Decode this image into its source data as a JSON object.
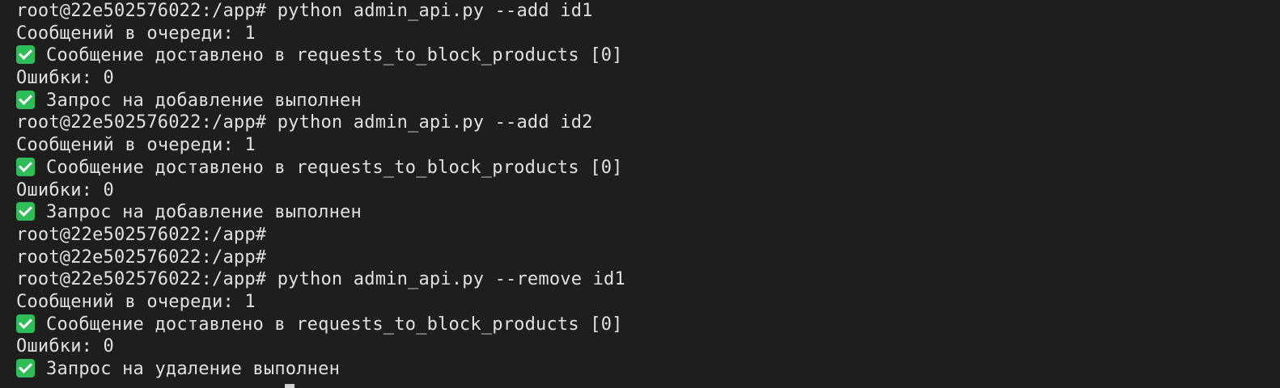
{
  "terminal": {
    "lines": [
      {
        "type": "cmd",
        "prompt": "root@22e502576022:/app#",
        "command": " python admin_api.py --add id1"
      },
      {
        "type": "text",
        "text": "Сообщений в очереди: 1"
      },
      {
        "type": "ok",
        "text": "Сообщение доставлено в requests_to_block_products [0]"
      },
      {
        "type": "text",
        "text": "Ошибки: 0"
      },
      {
        "type": "ok",
        "text": "Запрос на добавление выполнен"
      },
      {
        "type": "cmd",
        "prompt": "root@22e502576022:/app#",
        "command": " python admin_api.py --add id2"
      },
      {
        "type": "text",
        "text": "Сообщений в очереди: 1"
      },
      {
        "type": "ok",
        "text": "Сообщение доставлено в requests_to_block_products [0]"
      },
      {
        "type": "text",
        "text": "Ошибки: 0"
      },
      {
        "type": "ok",
        "text": "Запрос на добавление выполнен"
      },
      {
        "type": "cmd",
        "prompt": "root@22e502576022:/app#",
        "command": ""
      },
      {
        "type": "cmd",
        "prompt": "root@22e502576022:/app#",
        "command": ""
      },
      {
        "type": "cmd",
        "prompt": "root@22e502576022:/app#",
        "command": " python admin_api.py --remove id1"
      },
      {
        "type": "text",
        "text": "Сообщений в очереди: 1"
      },
      {
        "type": "ok",
        "text": "Сообщение доставлено в requests_to_block_products [0]"
      },
      {
        "type": "text",
        "text": "Ошибки: 0"
      },
      {
        "type": "ok",
        "text": "Запрос на удаление выполнен"
      }
    ],
    "icons": {
      "ok": "check-mark-icon"
    },
    "colors": {
      "background": "#1e1e1e",
      "text": "#e0e0e0",
      "check": "#2ebd59"
    }
  }
}
